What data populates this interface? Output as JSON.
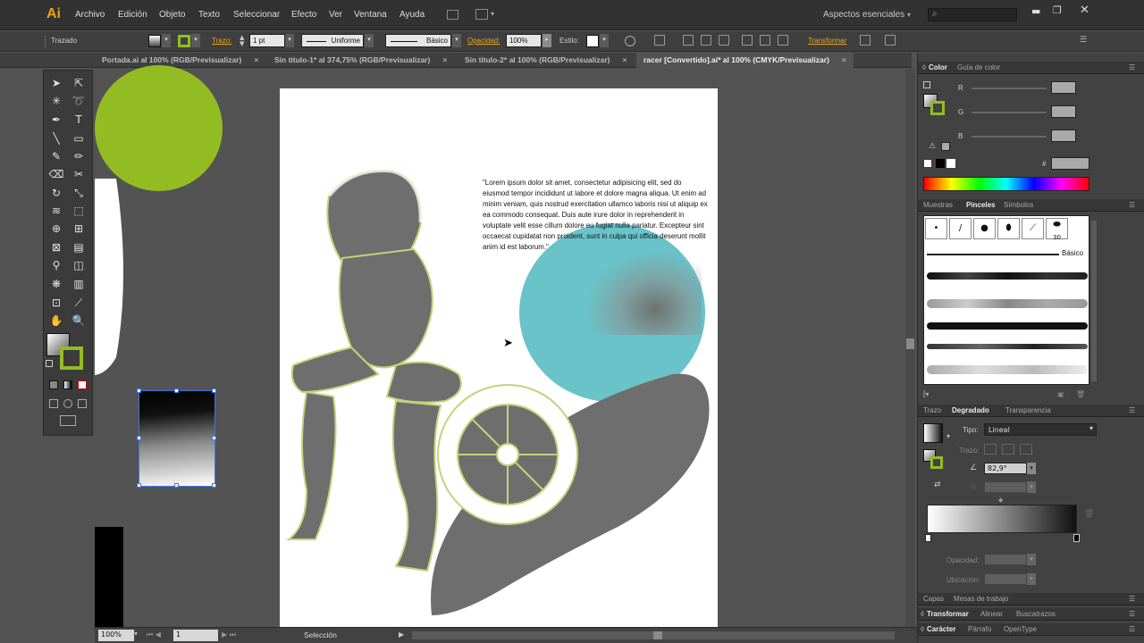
{
  "app": {
    "logo": "Ai"
  },
  "menu": [
    "Archivo",
    "Edición",
    "Objeto",
    "Texto",
    "Seleccionar",
    "Efecto",
    "Ver",
    "Ventana",
    "Ayuda"
  ],
  "workspace": {
    "label": "Aspectos esenciales",
    "search_placeholder": ""
  },
  "control": {
    "mode": "Trazado",
    "stroke_label": "Trazo:",
    "stroke_weight": "1 pt",
    "profile": "Uniforme",
    "brush": "Básico",
    "opacity_label": "Opacidad:",
    "opacity": "100%",
    "style_label": "Estilo:",
    "transform": "Transformar"
  },
  "tabs": [
    {
      "label": "Portada.ai al 100% (RGB/Previsualizar)",
      "close": "×"
    },
    {
      "label": "Sin título-1* al 374,75% (RGB/Previsualizar)",
      "close": "×"
    },
    {
      "label": "Sin título-2* al 100% (RGB/Previsualizar)",
      "close": "×"
    },
    {
      "label": "racer [Convertido].ai* al 100% (CMYK/Previsualizar)",
      "close": "×"
    }
  ],
  "artboard": {
    "text": "\"Lorem ipsum dolor sit amet, consectetur adipisicing elit, sed do eiusmod tempor incididunt ut labore et dolore magna aliqua. Ut enim ad minim veniam, quis nostrud exercitation ullamco laboris nisi ut aliquip ex ea commodo consequat. Duis aute irure dolor in reprehenderit in voluptate velit esse cillum dolore eu fugiat nulla pariatur. Excepteur sint occaecat cupidatat non proident, sunt in culpa qui officia deserunt mollit anim id est laborum.\""
  },
  "status": {
    "zoom": "100%",
    "artboard_num": "1",
    "tool": "Selección"
  },
  "panels": {
    "color": {
      "tab1": "Color",
      "tab2": "Guía de color",
      "r": "R",
      "g": "G",
      "b": "B",
      "hex": "#"
    },
    "brushes": {
      "tab1": "Muestras",
      "tab2": "Pinceles",
      "tab3": "Símbolos",
      "basic": "Básico",
      "size30": "30"
    },
    "gradient": {
      "tab1": "Trazo",
      "tab2": "Degradado",
      "tab3": "Transparencia",
      "type_label": "Tipo:",
      "type": "Lineal",
      "stroke_label": "Trazo:",
      "angle": "82,9°",
      "opacity_label": "Opacidad:",
      "location_label": "Ubicación:"
    },
    "bottom": {
      "tab1": "Capas",
      "tab2": "Mesas de trabajo",
      "tab3": "Transformar",
      "tab4": "Alinear",
      "tab5": "Buscatrazos",
      "tab6": "Carácter",
      "tab7": "Párrafo",
      "tab8": "OpenType"
    }
  },
  "colors": {
    "accent_green": "#93bc22",
    "cyan": "#69c3c8",
    "gray_art": "#6e6e6e",
    "outline": "#c5d27a"
  }
}
